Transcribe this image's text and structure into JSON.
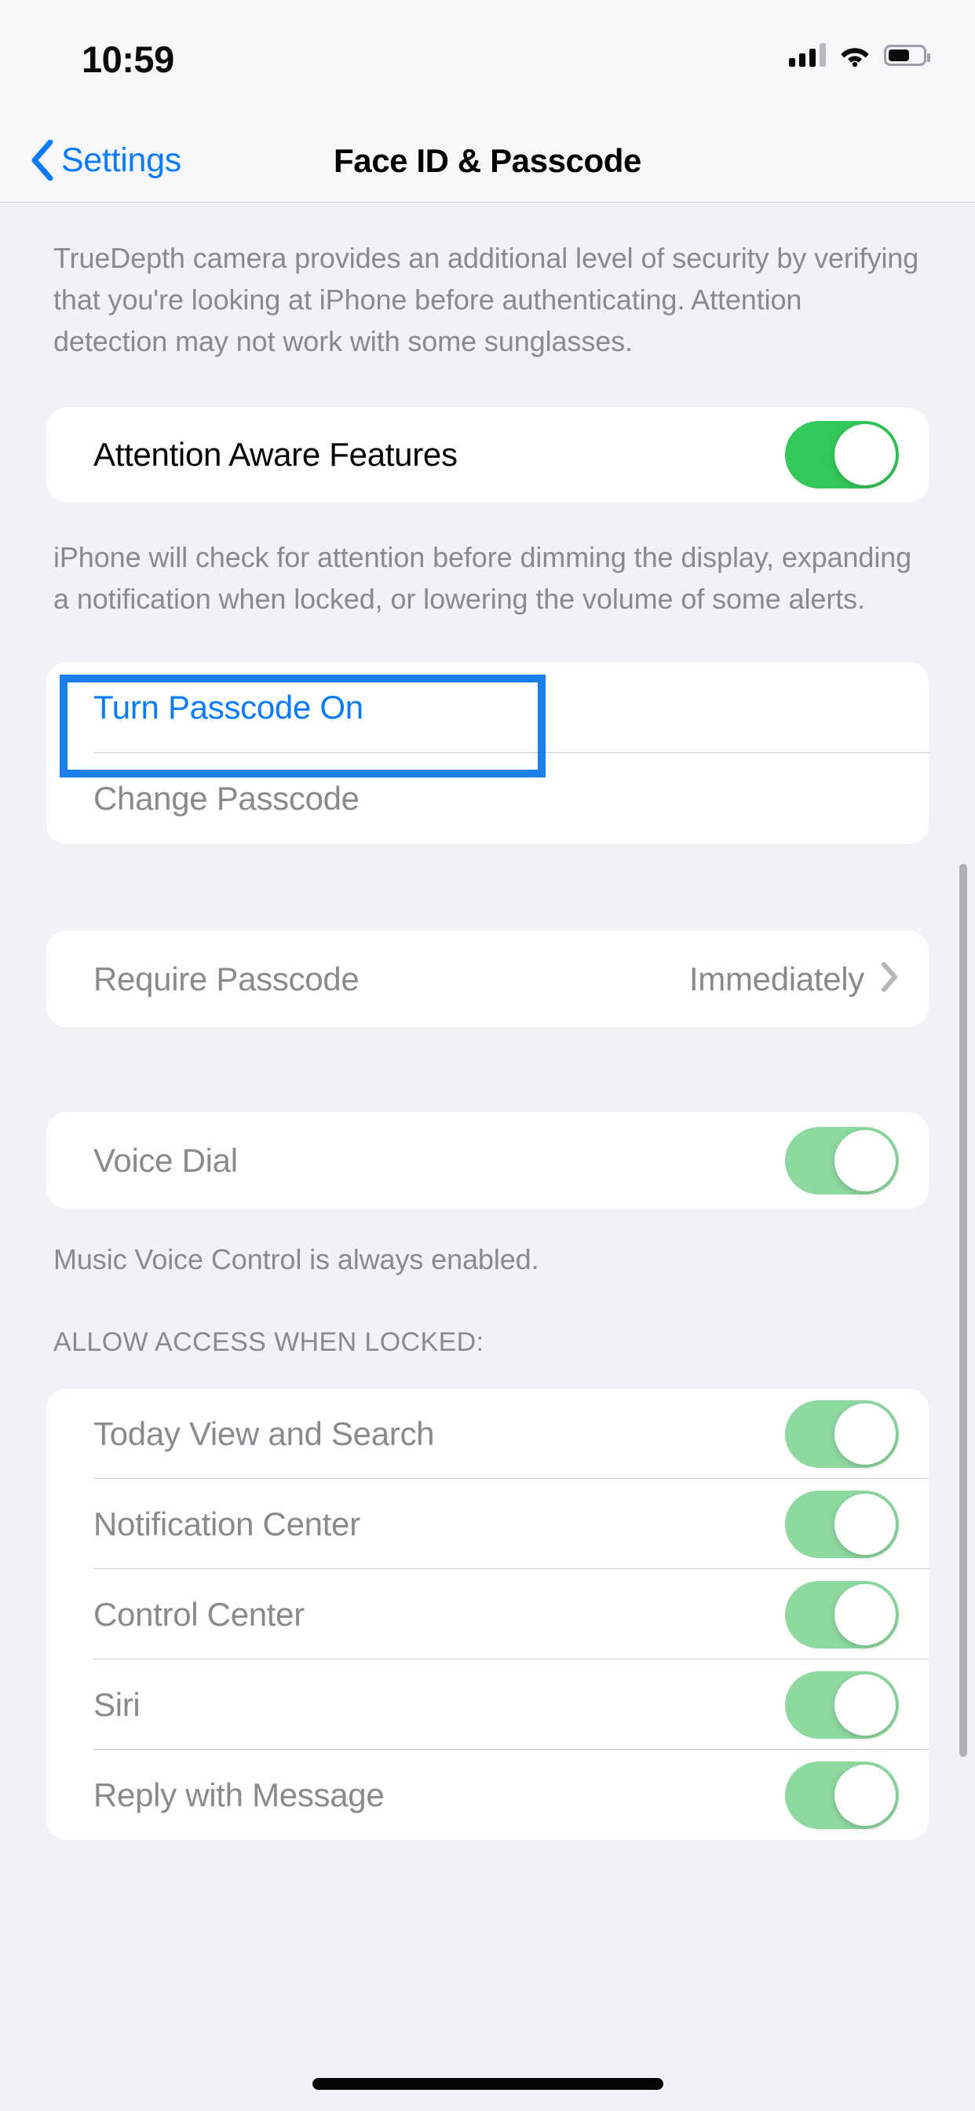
{
  "statusbar": {
    "time": "10:59",
    "cellular_icon": "cellular-signal-icon",
    "wifi_icon": "wifi-icon",
    "battery_icon": "battery-icon"
  },
  "navbar": {
    "back_label": "Settings",
    "back_icon": "chevron-left-icon",
    "title": "Face ID & Passcode"
  },
  "colors": {
    "accent_blue": "#0A7AFF",
    "focus_blue": "#1A7FE8",
    "toggle_on_green": "#34C759",
    "toggle_dim_green": "#8ED9A0",
    "page_background": "#F1F1F6",
    "card_background": "#FFFFFF",
    "secondary_text": "#8A8A8E"
  },
  "sections": {
    "truedepth_footnote": "TrueDepth camera provides an additional level of security by verifying that you're looking at iPhone before authenticating. Attention detection may not work with some sunglasses.",
    "attention": {
      "label": "Attention Aware Features",
      "toggle_state": "on",
      "footnote": "iPhone will check for attention before dimming the display, expanding a notification when locked, or lowering the volume of some alerts."
    },
    "passcode": {
      "turn_on_label": "Turn Passcode On",
      "change_label": "Change Passcode",
      "focused_row": "Turn Passcode On"
    },
    "require": {
      "label": "Require Passcode",
      "value": "Immediately",
      "chevron_icon": "chevron-right-icon"
    },
    "voice_dial": {
      "label": "Voice Dial",
      "toggle_state": "on-dim",
      "footnote": "Music Voice Control is always enabled."
    },
    "allow_access": {
      "header": "ALLOW ACCESS WHEN LOCKED:",
      "items": [
        {
          "label": "Today View and Search",
          "toggle_state": "on-dim"
        },
        {
          "label": "Notification Center",
          "toggle_state": "on-dim"
        },
        {
          "label": "Control Center",
          "toggle_state": "on-dim"
        },
        {
          "label": "Siri",
          "toggle_state": "on-dim"
        },
        {
          "label": "Reply with Message",
          "toggle_state": "on-dim"
        }
      ]
    }
  },
  "scrollbar": {
    "name": "vertical-scrollbar"
  },
  "home_indicator": {
    "name": "home-indicator"
  }
}
